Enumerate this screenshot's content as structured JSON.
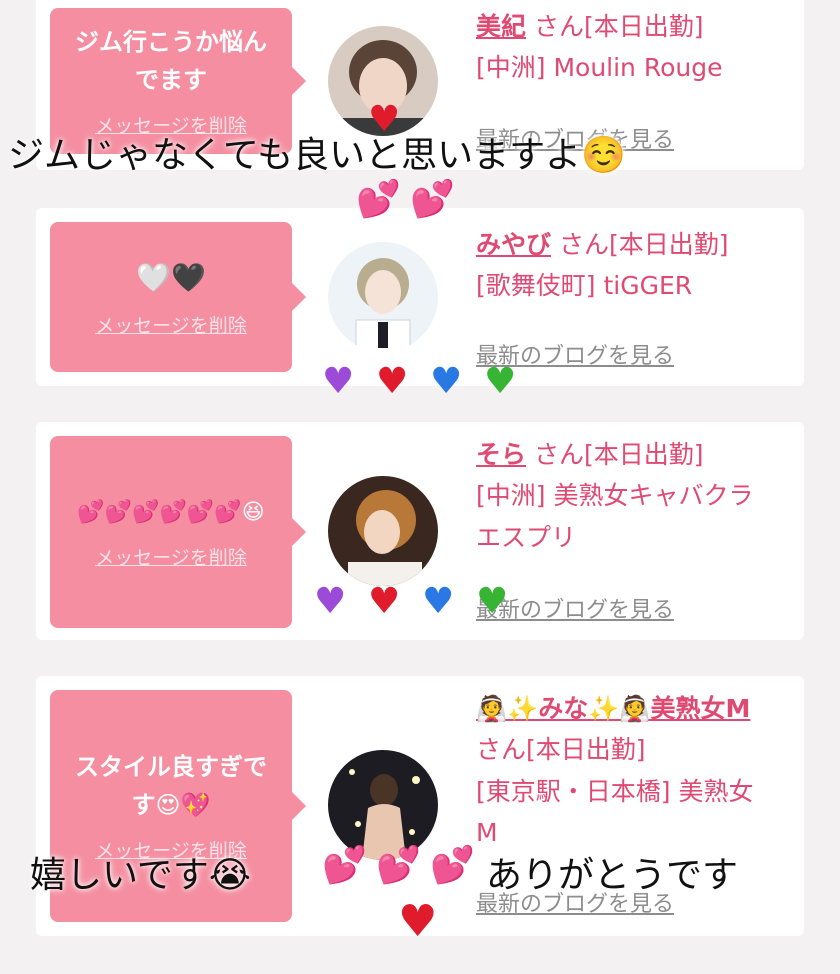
{
  "messages": [
    {
      "text": "ジム行こうか悩んでます",
      "delete_label": "メッセージを削除",
      "name": "美紀",
      "status": "さん[本日出勤]",
      "location": "[中洲] Moulin Rouge",
      "blog_label": "最新のブログを見る"
    },
    {
      "text": "🤍🖤",
      "delete_label": "メッセージを削除",
      "name": "みやび",
      "status": "さん[本日出勤]",
      "location": "[歌舞伎町] tiGGER",
      "blog_label": "最新のブログを見る"
    },
    {
      "text": "💕💕💕💕💕💕😆",
      "delete_label": "メッセージを削除",
      "name": "そら",
      "status": "さん[本日出勤]",
      "location": "[中洲] 美熟女キャバクラ エスプリ",
      "blog_label": "最新のブログを見る"
    },
    {
      "text": "スタイル良すぎです😍💖",
      "delete_label": "メッセージを削除",
      "name": "👰✨みな✨👰美熟女M",
      "status": "さん[本日出勤]",
      "location": "[東京駅・日本橋] 美熟女 M",
      "blog_label": "最新のブログを見る"
    }
  ],
  "overlays": {
    "caption_top": "ジムじゃなくても良いと思いますよ☺️",
    "caption_bottom_left": "嬉しいです😭",
    "caption_bottom_right": "ありがとうです"
  },
  "colors": {
    "bubble": "#f48ea0",
    "name": "#e04a72",
    "link_gray": "#8d8d8d"
  }
}
